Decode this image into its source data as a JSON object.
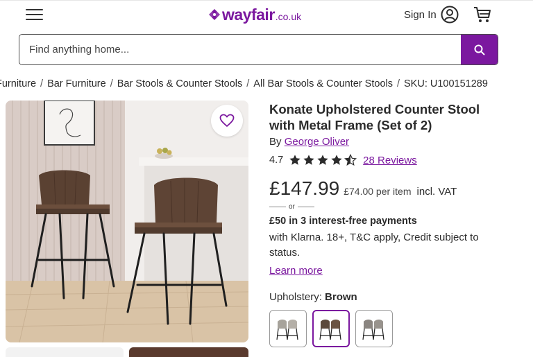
{
  "header": {
    "logo_text": "wayfair",
    "logo_tld": ".co.uk",
    "sign_in_label": "Sign In"
  },
  "search": {
    "placeholder": "Find anything home..."
  },
  "breadcrumb": {
    "items": [
      "Furniture",
      "Bar Furniture",
      "Bar Stools & Counter Stools",
      "All Bar Stools & Counter Stools"
    ],
    "sku": "SKU: U100151289"
  },
  "product": {
    "title": "Konate Upholstered Counter Stool with Metal Frame (Set of 2)",
    "by_label": "By",
    "brand": "George Oliver",
    "rating": "4.7",
    "stars_value": 4.7,
    "stars_max": 5,
    "reviews": "28 Reviews",
    "price": "£147.99",
    "per_item": "£74.00 per item",
    "vat": "incl. VAT",
    "or_label": "or",
    "klarna_head": "£50 in 3 interest-free payments",
    "klarna_body": "with Klarna. 18+, T&C apply, Credit subject to status.",
    "learn_more": "Learn more",
    "upholstery_label": "Upholstery:",
    "upholstery_value": "Brown"
  },
  "swatches": [
    {
      "name": "Light Grey",
      "selected": false,
      "color": "#a7a39b"
    },
    {
      "name": "Brown",
      "selected": true,
      "color": "#5c4a3c"
    },
    {
      "name": "Grey",
      "selected": false,
      "color": "#8a8580"
    }
  ],
  "colors": {
    "brand": "#7b189f",
    "text": "#2b2b2b"
  },
  "icons": [
    "menu-icon",
    "account-icon",
    "cart-icon",
    "search-icon",
    "heart-icon",
    "star-icon"
  ]
}
